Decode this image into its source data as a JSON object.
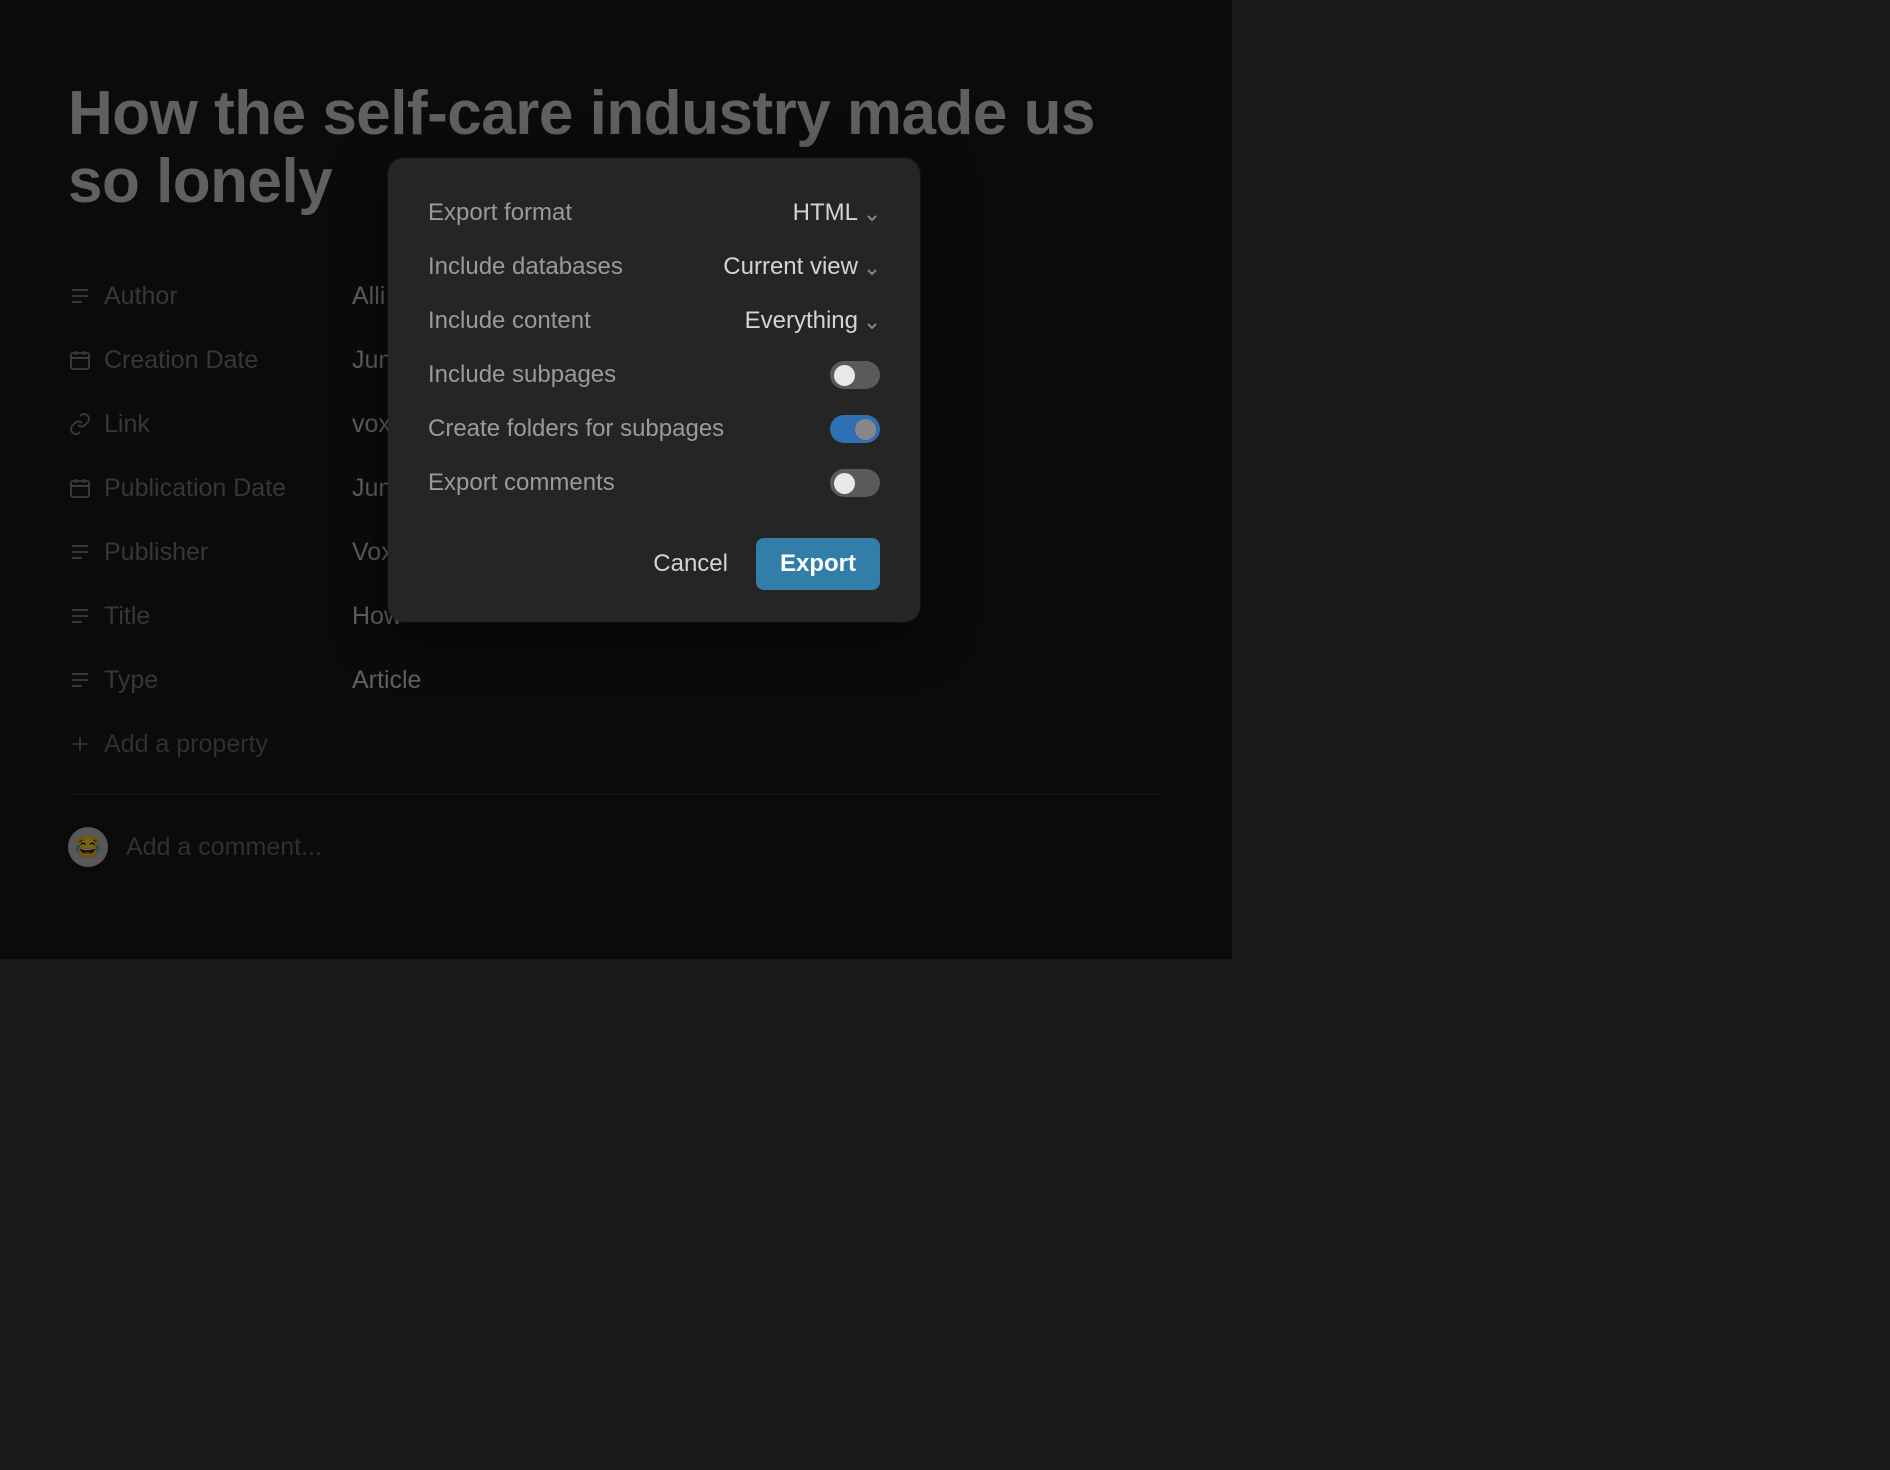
{
  "page": {
    "title": "How the self-care industry made us so lonely"
  },
  "properties": [
    {
      "icon": "text",
      "label": "Author",
      "value": "Alli"
    },
    {
      "icon": "calendar",
      "label": "Creation Date",
      "value": "Jun"
    },
    {
      "icon": "link",
      "label": "Link",
      "value": "vox"
    },
    {
      "icon": "calendar",
      "label": "Publication Date",
      "value": "Jun"
    },
    {
      "icon": "text",
      "label": "Publisher",
      "value": "Vox"
    },
    {
      "icon": "text",
      "label": "Title",
      "value": "How"
    },
    {
      "icon": "text",
      "label": "Type",
      "value": "Article"
    }
  ],
  "add_property_label": "Add a property",
  "comment": {
    "placeholder": "Add a comment..."
  },
  "modal": {
    "rows": {
      "export_format": {
        "label": "Export format",
        "value": "HTML"
      },
      "include_db": {
        "label": "Include databases",
        "value": "Current view"
      },
      "include_content": {
        "label": "Include content",
        "value": "Everything"
      },
      "include_subpages": {
        "label": "Include subpages",
        "on": false
      },
      "create_folders": {
        "label": "Create folders for subpages",
        "on": true
      },
      "export_comments": {
        "label": "Export comments",
        "on": false
      }
    },
    "cancel_label": "Cancel",
    "export_label": "Export"
  }
}
